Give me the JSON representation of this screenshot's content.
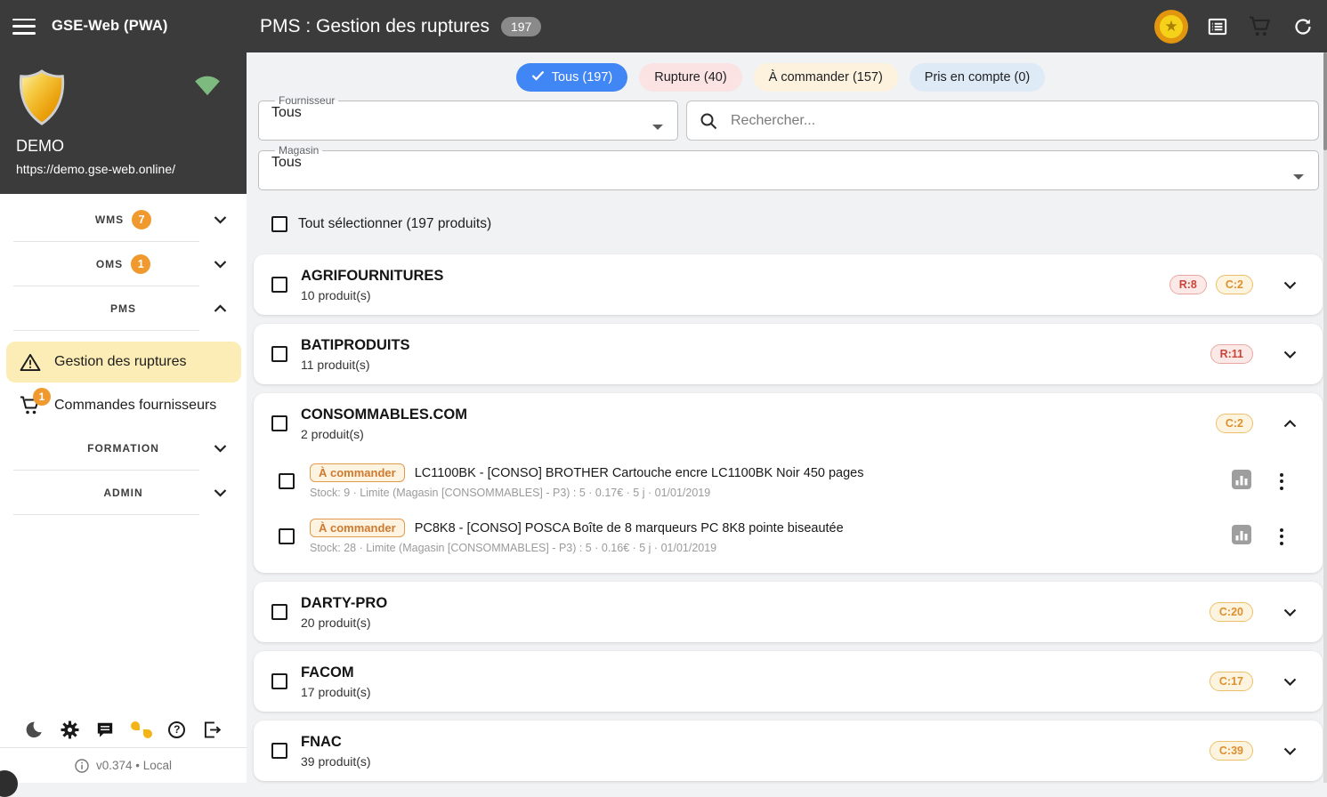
{
  "header": {
    "app_title": "GSE-Web (PWA)",
    "page_title": "PMS : Gestion des ruptures",
    "count_badge": "197"
  },
  "icons": {
    "star_glyph": "★",
    "help_glyph": "?"
  },
  "sidebar": {
    "profile": {
      "name": "DEMO",
      "url": "https://demo.gse-web.online/"
    },
    "menu": [
      {
        "type": "group",
        "label": "WMS",
        "badge": "7",
        "expanded": false
      },
      {
        "type": "group",
        "label": "OMS",
        "badge": "1",
        "expanded": false
      },
      {
        "type": "group",
        "label": "PMS",
        "badge": null,
        "expanded": true
      },
      {
        "type": "item",
        "label": "Gestion des ruptures",
        "icon": "warning",
        "active": true
      },
      {
        "type": "item",
        "label": "Commandes fournisseurs",
        "icon": "cart",
        "badge": "1",
        "active": false
      },
      {
        "type": "group",
        "label": "FORMATION",
        "badge": null,
        "expanded": false
      },
      {
        "type": "group",
        "label": "ADMIN",
        "badge": null,
        "expanded": false
      }
    ],
    "version": "v0.374 • Local"
  },
  "filters": {
    "chips": [
      {
        "label": "Tous (197)",
        "type": "active",
        "checked": true
      },
      {
        "label": "Rupture (40)",
        "type": "rupture",
        "checked": false
      },
      {
        "label": "À commander (157)",
        "type": "commander",
        "checked": false
      },
      {
        "label": "Pris en compte (0)",
        "type": "pris",
        "checked": false
      }
    ],
    "fournisseur": {
      "label": "Fournisseur",
      "value": "Tous"
    },
    "magasin": {
      "label": "Magasin",
      "value": "Tous"
    },
    "search_placeholder": "Rechercher..."
  },
  "select_all_label": "Tout sélectionner (197 produits)",
  "suppliers": [
    {
      "name": "AGRIFOURNITURES",
      "count": "10 produit(s)",
      "badges": [
        {
          "text": "R:8",
          "type": "r"
        },
        {
          "text": "C:2",
          "type": "c"
        }
      ],
      "expanded": false,
      "products": []
    },
    {
      "name": "BATIPRODUITS",
      "count": "11 produit(s)",
      "badges": [
        {
          "text": "R:11",
          "type": "r"
        }
      ],
      "expanded": false,
      "products": []
    },
    {
      "name": "CONSOMMABLES.COM",
      "count": "2 produit(s)",
      "badges": [
        {
          "text": "C:2",
          "type": "c"
        }
      ],
      "expanded": true,
      "products": [
        {
          "chip": "À commander",
          "title": "LC1100BK - [CONSO] BROTHER Cartouche encre LC1100BK Noir 450 pages",
          "details": "Stock: 9 · Limite (Magasin [CONSOMMABLES] - P3) : 5 · 0.17€ · 5 j · 01/01/2019"
        },
        {
          "chip": "À commander",
          "title": "PC8K8 - [CONSO] POSCA Boîte de 8 marqueurs PC 8K8 pointe biseautée",
          "details": "Stock: 28 · Limite (Magasin [CONSOMMABLES] - P3) : 5 · 0.16€ · 5 j · 01/01/2019"
        }
      ]
    },
    {
      "name": "DARTY-PRO",
      "count": "20 produit(s)",
      "badges": [
        {
          "text": "C:20",
          "type": "c"
        }
      ],
      "expanded": false,
      "products": []
    },
    {
      "name": "FACOM",
      "count": "17 produit(s)",
      "badges": [
        {
          "text": "C:17",
          "type": "c"
        }
      ],
      "expanded": false,
      "products": []
    },
    {
      "name": "FNAC",
      "count": "39 produit(s)",
      "badges": [
        {
          "text": "C:39",
          "type": "c"
        }
      ],
      "expanded": false,
      "products": []
    }
  ],
  "colors": {
    "header_dark": "#3b3b3b",
    "accent_blue": "#4186f5",
    "badge_orange": "#f0992e",
    "active_yellow": "#fcedb6",
    "rupture_red": "#c9453a",
    "commander_orange": "#dd8f2d"
  }
}
